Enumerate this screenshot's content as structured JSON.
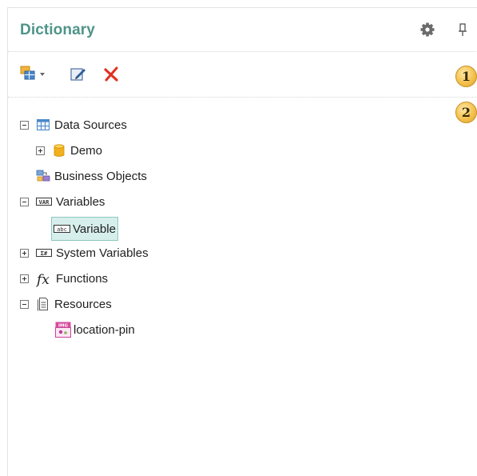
{
  "panel": {
    "title": "Dictionary",
    "settings_icon": "gear-icon",
    "pin_icon": "pin-icon"
  },
  "toolbar": {
    "actions": [
      {
        "name": "new-item-dropdown",
        "icon": "new-item-icon"
      },
      {
        "name": "edit",
        "icon": "edit-icon"
      },
      {
        "name": "delete",
        "icon": "delete-icon",
        "color": "#e0321f"
      }
    ]
  },
  "badges": [
    "1",
    "2"
  ],
  "tree": [
    {
      "label": "Data Sources",
      "icon": "datasource-table-icon",
      "expander": "collapse"
    },
    {
      "label": "Demo",
      "icon": "database-icon",
      "expander": "expand"
    },
    {
      "label": "Business Objects",
      "icon": "business-objects-icon",
      "expander": "none"
    },
    {
      "label": "Variables",
      "icon": "var-icon",
      "expander": "collapse"
    },
    {
      "label": "Variable",
      "icon": "abc-icon",
      "expander": "none",
      "selected": true
    },
    {
      "label": "System Variables",
      "icon": "system-variables-icon",
      "expander": "expand"
    },
    {
      "label": "Functions",
      "icon": "fx-icon",
      "expander": "expand"
    },
    {
      "label": "Resources",
      "icon": "resources-icon",
      "expander": "collapse"
    },
    {
      "label": "location-pin",
      "icon": "image-resource-icon",
      "expander": "none"
    }
  ],
  "colors": {
    "accent": "#4f9488",
    "selection": "#d7efec",
    "badge": "#f3c14f"
  }
}
